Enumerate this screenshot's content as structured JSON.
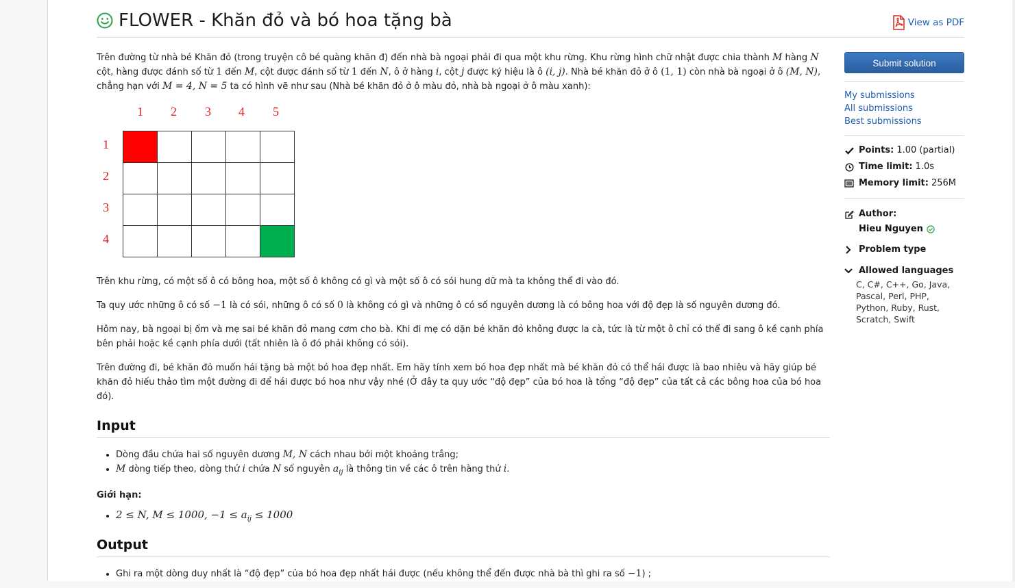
{
  "problem": {
    "title": "FLOWER - Khăn đỏ và bó hoa tặng bà",
    "pdf_label": "View as PDF"
  },
  "statement": {
    "p1": {
      "t1": "Trên đường từ nhà bé Khăn đỏ (trong truyện cô bé quàng khăn đ) đến nhà bà ngoại phải đi qua một khu rừng. Khu rừng hình chữ nhật được chia thành ",
      "m1": "M",
      "t2": " hàng ",
      "m2": "N",
      "t3": " cột, hàng được đánh số từ ",
      "m3": "1",
      "t4": " đến ",
      "m4": "M",
      "t5": ", cột được đánh số từ ",
      "m5": "1",
      "t6": " đến ",
      "m6": "N",
      "t7": ", ô ở hàng ",
      "m7": "i",
      "t8": ", cột ",
      "m8": "j",
      "t9": " được ký hiệu là ô ",
      "m9": "(i, j)",
      "t10": ". Nhà bé khăn đỏ ở ô ",
      "m10": "(1, 1)",
      "t11": " còn nhà bà ngoại ở ô ",
      "m11": "(M, N)",
      "t12": ", chẳng hạn với ",
      "m12": "M = 4, N = 5",
      "t13": " ta có hình vẽ như sau (Nhà bé khăn đỏ ở ô màu đỏ, nhà bà ngoại ở ô màu xanh):"
    },
    "grid": {
      "cols": [
        "1",
        "2",
        "3",
        "4",
        "5"
      ],
      "rows": [
        "1",
        "2",
        "3",
        "4"
      ],
      "start_color": "#ff0000",
      "end_color": "#00b050"
    },
    "p2": "Trên khu rừng, có một số ô có bông hoa, một số ô không có gì và một số ô có sói hung dữ mà ta không thể đi vào đó.",
    "p3": {
      "t1": "Ta quy ước những ô có số ",
      "m1": "−1",
      "t2": " là có sói, những ô có số ",
      "m2": "0",
      "t3": " là không có gì và những ô có số nguyên dương là có bông hoa với độ đẹp là số nguyên dương đó."
    },
    "p4": "Hôm nay, bà ngoại bị ốm và mẹ sai bé khăn đỏ mang cơm cho bà. Khi đi mẹ có dặn bé khăn đỏ không được la cà, tức là từ một ô chỉ có thể đi sang ô kề cạnh phía bên phải hoặc kề cạnh phía dưới (tất nhiên là ô đó phải không có sói).",
    "p5": "Trên đường đi, bé khăn đỏ muốn hái tặng bà một bó hoa đẹp nhất. Em hãy tính xem bó hoa đẹp nhất mà bé khăn đỏ có thể hái được là bao nhiêu và hãy giúp bé khăn đỏ hiếu thảo tìm một đường đi để hái được bó hoa như vậy nhé (Ở đây ta quy ước “độ đẹp” của bó hoa là tổng “độ đẹp” của tất cả các bông hoa của bó hoa đó)."
  },
  "input": {
    "heading": "Input",
    "li1": {
      "t1": "Dòng đầu chứa hai số nguyên dương ",
      "m1": "M, N",
      "t2": " cách nhau bởi một khoảng trắng;"
    },
    "li2": {
      "m1": "M",
      "t1": " dòng tiếp theo, dòng thứ ",
      "m2": "i",
      "t2": " chứa ",
      "m3": "N",
      "t3": " số nguyên ",
      "m4": "a",
      "m4sub": "ij",
      "t4": " là thông tin về các ô trên hàng thứ ",
      "m5": "i",
      "t5": "."
    },
    "limits_label": "Giới hạn:",
    "limit1": {
      "a": "2 ≤ N, M ≤ 1000, −1 ≤ ",
      "b": "a",
      "bsub": "ij",
      "c": " ≤ 1000"
    }
  },
  "output": {
    "heading": "Output",
    "li1": {
      "t1": "Ghi ra một dòng duy nhất là “độ đẹp” của bó hoa đẹp nhất hái được (nếu không thể đến được nhà bà thì ghi ra số ",
      "m1": "−1",
      "t2": ") ;"
    }
  },
  "sidebar": {
    "submit_label": "Submit solution",
    "links": [
      "My submissions",
      "All submissions",
      "Best submissions"
    ],
    "points_label": "Points:",
    "points_value": "1.00 (partial)",
    "time_label": "Time limit:",
    "time_value": "1.0s",
    "memory_label": "Memory limit:",
    "memory_value": "256M",
    "author_label": "Author:",
    "author_name": "Hieu Nguyen",
    "problem_type_label": "Problem type",
    "languages_label": "Allowed languages",
    "languages": "C, C#, C++, Go, Java, Pascal, Perl, PHP, Python, Ruby, Rust, Scratch, Swift"
  },
  "colors": {
    "accent": "#1e5fb3",
    "smiley": "#2ca24a",
    "pdf_red": "#d9261c"
  }
}
